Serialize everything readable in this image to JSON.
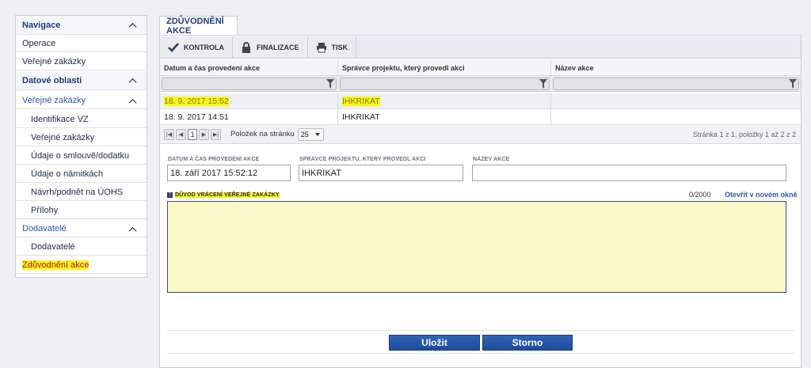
{
  "sidebar": {
    "items": [
      {
        "label": "Navigace",
        "kind": "head",
        "chevron": true
      },
      {
        "label": "Operace",
        "kind": "item"
      },
      {
        "label": "Veřejné zakázky",
        "kind": "item"
      },
      {
        "label": "Datové oblasti",
        "kind": "head",
        "chevron": true
      },
      {
        "label": "Veřejné zakázky",
        "kind": "group",
        "chevron": true
      },
      {
        "label": "Identifikace VZ",
        "kind": "sub"
      },
      {
        "label": "Veřejné zakázky",
        "kind": "sub"
      },
      {
        "label": "Údaje o smlouvě/dodatku",
        "kind": "sub"
      },
      {
        "label": "Údaje o námitkách",
        "kind": "sub"
      },
      {
        "label": "Návrh/podnět na ÚOHS",
        "kind": "sub"
      },
      {
        "label": "Přílohy",
        "kind": "sub"
      },
      {
        "label": "Dodavatelé",
        "kind": "group",
        "chevron": true
      },
      {
        "label": "Dodavatelé",
        "kind": "sub"
      },
      {
        "label": "Zdůvodnění akce",
        "kind": "item",
        "active": true
      }
    ]
  },
  "tab": {
    "label": "ZDŮVODNĚNÍ AKCE"
  },
  "toolbar": {
    "kontrola": "KONTROLA",
    "finalizace": "FINALIZACE",
    "tisk": "TISK"
  },
  "grid": {
    "columns": [
      "Datum a čas provedení akce",
      "Správce projektu, který provedl akci",
      "Název akce"
    ],
    "rows": [
      {
        "datum": "18. 9. 2017 15:52",
        "spravce": "IHKRIKAT",
        "nazev": "",
        "selected": true
      },
      {
        "datum": "18. 9. 2017 14:51",
        "spravce": "IHKRIKAT",
        "nazev": "",
        "selected": false
      }
    ]
  },
  "pager": {
    "current_page": "1",
    "per_page_label": "Položek na stránku",
    "per_page_value": "25",
    "summary": "Stránka 1 z 1, položky 1 až 2 z 2"
  },
  "form": {
    "datum_label": "DATUM A ČAS PROVEDENÍ AKCE",
    "datum_value": "18. září 2017 15:52:12",
    "spravce_label": "SPRÁVCE PROJEKTU, KTERÝ PROVEDL AKCI",
    "spravce_value": "IHKRIKAT",
    "nazev_label": "NÁZEV AKCE",
    "nazev_value": "",
    "duvod_label": "DŮVOD VRÁCENÍ VEŘEJNÉ ZAKÁZKY",
    "duvod_value": "",
    "counter": "0/2000",
    "open_new_window": "Otevřít v novém okně"
  },
  "buttons": {
    "save": "Uložit",
    "cancel": "Storno"
  },
  "colors": {
    "highlight": "#f7f51e",
    "accent": "#1f3b82",
    "textarea_bg": "#fbf8c8"
  }
}
